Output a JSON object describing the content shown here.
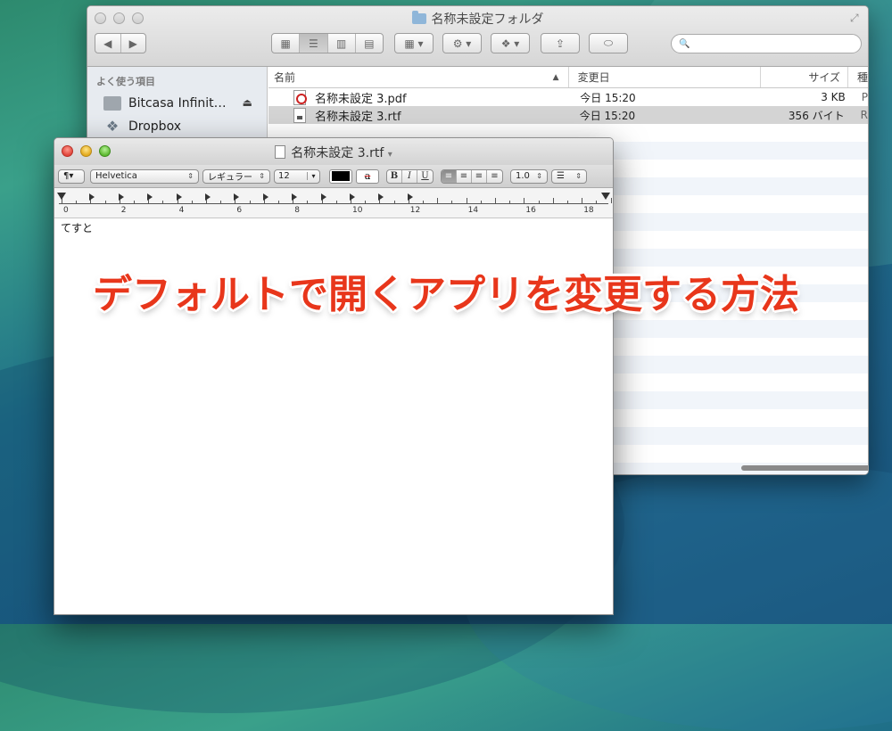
{
  "finder": {
    "title": "名称未設定フォルダ",
    "sidebar": {
      "section_title": "よく使う項目",
      "items": [
        {
          "label": "Bitcasa Infinit…",
          "icon": "folder-icon"
        },
        {
          "label": "Dropbox",
          "icon": "dropbox-icon"
        }
      ]
    },
    "columns": {
      "name": "名前",
      "date": "変更日",
      "size": "サイズ",
      "kind": "種"
    },
    "rows": [
      {
        "name": "名称未設定 3.pdf",
        "date": "今日 15:20",
        "size": "3 KB",
        "kind": "P",
        "icon": "pdf-file-icon"
      },
      {
        "name": "名称未設定 3.rtf",
        "date": "今日 15:20",
        "size": "356 バイト",
        "kind": "R",
        "icon": "rtf-file-icon"
      }
    ],
    "toolbar": {
      "back": "◀",
      "forward": "▶",
      "view_icon": "▦",
      "view_list": "☰",
      "view_column": "▥",
      "view_coverflow": "▤",
      "arrange": "▦ ▾",
      "action": "⚙ ▾",
      "dropbox": "❖ ▾",
      "share": "⇪",
      "tags": "⬭",
      "search_icon": "🔍",
      "fullscreen": "⤢"
    }
  },
  "textedit": {
    "title": "名称未設定 3.rtf",
    "title_arrow": "▾",
    "toolbar": {
      "paragraph": "¶▾",
      "font": "Helvetica",
      "style": "レギュラー",
      "size": "12",
      "size_arrow": "▾",
      "bold": "B",
      "italic": "I",
      "underline": "U",
      "align_left": "≡",
      "align_center": "≡",
      "align_right": "≡",
      "align_justify": "≡",
      "spacing": "1.0",
      "list": "☰",
      "updown": "⇕",
      "text_color_glyph": "a"
    },
    "ruler_numbers": [
      "0",
      "2",
      "4",
      "6",
      "8",
      "10",
      "12",
      "14",
      "16",
      "18"
    ],
    "body_text": "てすと"
  },
  "caption": "デフォルトで開くアプリを変更する方法",
  "colors": {
    "caption_red": "#e8361b",
    "selection_gray": "#d4d4d4",
    "sidebar_bg": "#e7ebf0"
  }
}
